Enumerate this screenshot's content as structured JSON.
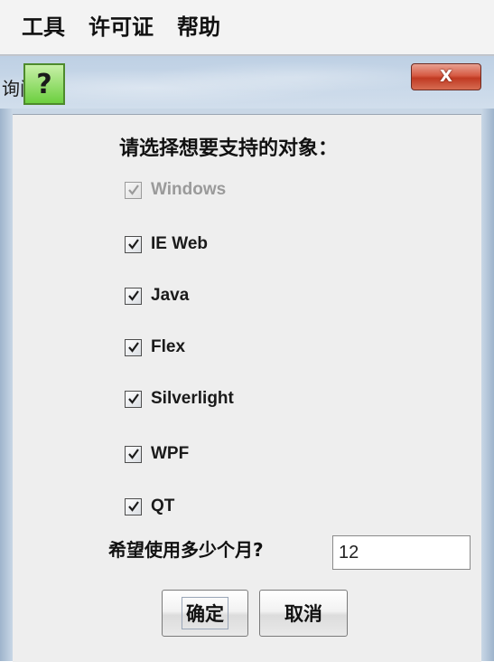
{
  "menubar": {
    "items": [
      "工具",
      "许可证",
      "帮助"
    ]
  },
  "dialog": {
    "title": "询问",
    "close_symbol": "X",
    "icon_symbol": "?",
    "prompt": "请选择想要支持的对象：",
    "options": [
      {
        "label": "Windows",
        "checked": true,
        "disabled": true
      },
      {
        "label": "IE Web",
        "checked": true,
        "disabled": false
      },
      {
        "label": "Java",
        "checked": true,
        "disabled": false
      },
      {
        "label": "Flex",
        "checked": true,
        "disabled": false
      },
      {
        "label": "Silverlight",
        "checked": true,
        "disabled": false
      },
      {
        "label": "WPF",
        "checked": true,
        "disabled": false
      },
      {
        "label": "QT",
        "checked": true,
        "disabled": false
      }
    ],
    "months_label": "希望使用多少个月?",
    "months_value": "12",
    "ok_label": "确定",
    "cancel_label": "取消"
  },
  "colors": {
    "icon_green": "#6ccf3f",
    "close_red": "#c03a22",
    "check_mark": "#1a1a1a"
  }
}
